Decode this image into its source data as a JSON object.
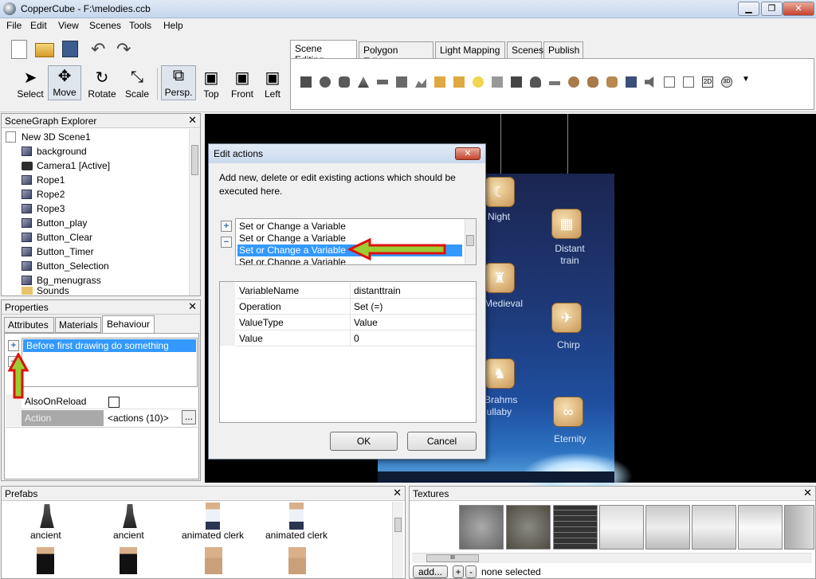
{
  "window": {
    "title": "CopperCube - F:\\melodies.ccb",
    "minimize": "▁",
    "maximize": "❐",
    "close": "✕"
  },
  "menu": [
    "File",
    "Edit",
    "View",
    "Scenes",
    "Tools",
    "Help"
  ],
  "toolbar": {
    "tools": [
      "Select",
      "Move",
      "Rotate",
      "Scale"
    ],
    "views": [
      "Persp.",
      "Top",
      "Front",
      "Left"
    ]
  },
  "editor_tabs": [
    "Scene Editing",
    "Polygon Editing",
    "Light Mapping",
    "Scenes",
    "Publish"
  ],
  "scenegraph": {
    "title": "SceneGraph Explorer",
    "close": "✕",
    "root": "New 3D Scene1",
    "items": [
      "background",
      "Camera1 [Active]",
      "Rope1",
      "Rope2",
      "Rope3",
      "Button_play",
      "Button_Clear",
      "Button_Timer",
      "Button_Selection",
      "Bg_menugrass",
      "Sounds"
    ]
  },
  "properties": {
    "title": "Properties",
    "close": "✕",
    "tabs": [
      "Attributes",
      "Materials",
      "Behaviour"
    ],
    "behaviour_item": "Before first drawing do something",
    "add": "+",
    "remove": "−",
    "rows": [
      {
        "key": "AlsoOnReload",
        "value": ""
      },
      {
        "key": "Action",
        "value": "<actions (10)>"
      }
    ],
    "ellipsis": "..."
  },
  "dialog": {
    "title": "Edit actions",
    "close": "✕",
    "description": "Add new, delete or edit existing actions which should be executed here.",
    "actions": [
      "Set or Change a Variable",
      "Set or Change a Variable",
      "Set or Change a Variable",
      "Set or Change a Variable"
    ],
    "selected_index": 2,
    "props": [
      {
        "key": "VariableName",
        "value": "distanttrain"
      },
      {
        "key": "Operation",
        "value": "Set (=)"
      },
      {
        "key": "ValueType",
        "value": "Value"
      },
      {
        "key": "Value",
        "value": "0"
      }
    ],
    "ok": "OK",
    "cancel": "Cancel"
  },
  "scene_labels": {
    "night": "Night",
    "distant_train_1": "Distant",
    "distant_train_2": "train",
    "medieval": "Medieval",
    "chirp": "Chirp",
    "brahms_1": "Brahms",
    "brahms_2": "lullaby",
    "eternity": "Eternity"
  },
  "prefabs": {
    "title": "Prefabs",
    "close": "✕",
    "items": [
      "ancient",
      "ancient",
      "animated clerk",
      "animated clerk"
    ]
  },
  "textures": {
    "title": "Textures",
    "close": "✕",
    "add": "add...",
    "plus": "+",
    "minus": "-",
    "status": "none selected",
    "scroll_grip": "III"
  },
  "colors": {
    "selection": "#3399ff",
    "arrow_fill": "#9acd32",
    "arrow_border": "#e01010"
  }
}
